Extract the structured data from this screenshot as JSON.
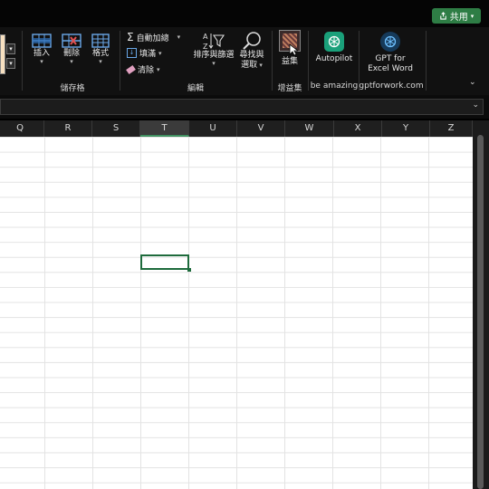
{
  "titlebar": {
    "share_label": "共用",
    "share_icon": "share-icon"
  },
  "ribbon": {
    "cells_group": {
      "label": "儲存格",
      "insert_label": "插入",
      "delete_label": "刪除",
      "format_label": "格式"
    },
    "editing_group": {
      "label": "編輯",
      "autosum_label": "自動加總",
      "fill_label": "填滿",
      "clear_label": "清除",
      "sort_filter_label_1": "排序與篩選",
      "find_select_label_1": "尋找與",
      "find_select_label_2": "選取"
    },
    "addins_group": {
      "label": "增益集",
      "button_label": "益集"
    },
    "autopilot": {
      "label": "Autopilot",
      "group_label": "be amazing"
    },
    "gpt": {
      "label_1": "GPT for",
      "label_2": "Excel Word",
      "group_label": "gptforwork.com"
    },
    "accent_color": "#2e7d45"
  },
  "formula_bar": {
    "value": ""
  },
  "sheet": {
    "columns": [
      "Q",
      "R",
      "S",
      "T",
      "U",
      "V",
      "W",
      "X",
      "Y",
      "Z"
    ],
    "selected_column": "T",
    "selection_color": "#1e6b3c"
  }
}
